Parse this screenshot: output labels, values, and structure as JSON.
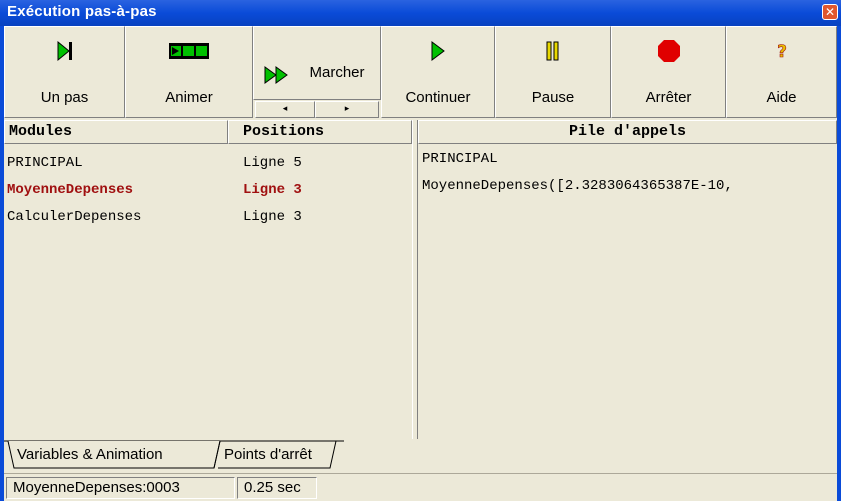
{
  "window": {
    "title": "Exécution pas-à-pas",
    "close_symbol": "✕"
  },
  "toolbar": {
    "step_label": "Un pas",
    "animate_label": "Animer",
    "walk_label": "Marcher",
    "walk_left_arrow": "◂",
    "walk_right_arrow": "▸",
    "continue_label": "Continuer",
    "pause_label": "Pause",
    "stop_label": "Arrêter",
    "help_label": "Aide",
    "colors": {
      "green": "#00c000",
      "yellow": "#e8d800",
      "red": "#e00000"
    }
  },
  "modules": {
    "header_modules": "Modules",
    "header_positions": "Positions",
    "rows": [
      {
        "module": "PRINCIPAL",
        "position": "Ligne 5",
        "active": false
      },
      {
        "module": "MoyenneDepenses",
        "position": "Ligne 3",
        "active": true
      },
      {
        "module": "CalculerDepenses",
        "position": "Ligne 3",
        "active": false
      }
    ]
  },
  "callstack": {
    "header": "Pile d'appels",
    "lines": [
      "PRINCIPAL",
      "MoyenneDepenses([2.3283064365387E-10,"
    ]
  },
  "tabs": {
    "variables_label": "Variables & Animation",
    "breakpoints_label": "Points d'arrêt"
  },
  "status": {
    "position": "MoyenneDepenses:0003",
    "time": "0.25 sec"
  }
}
